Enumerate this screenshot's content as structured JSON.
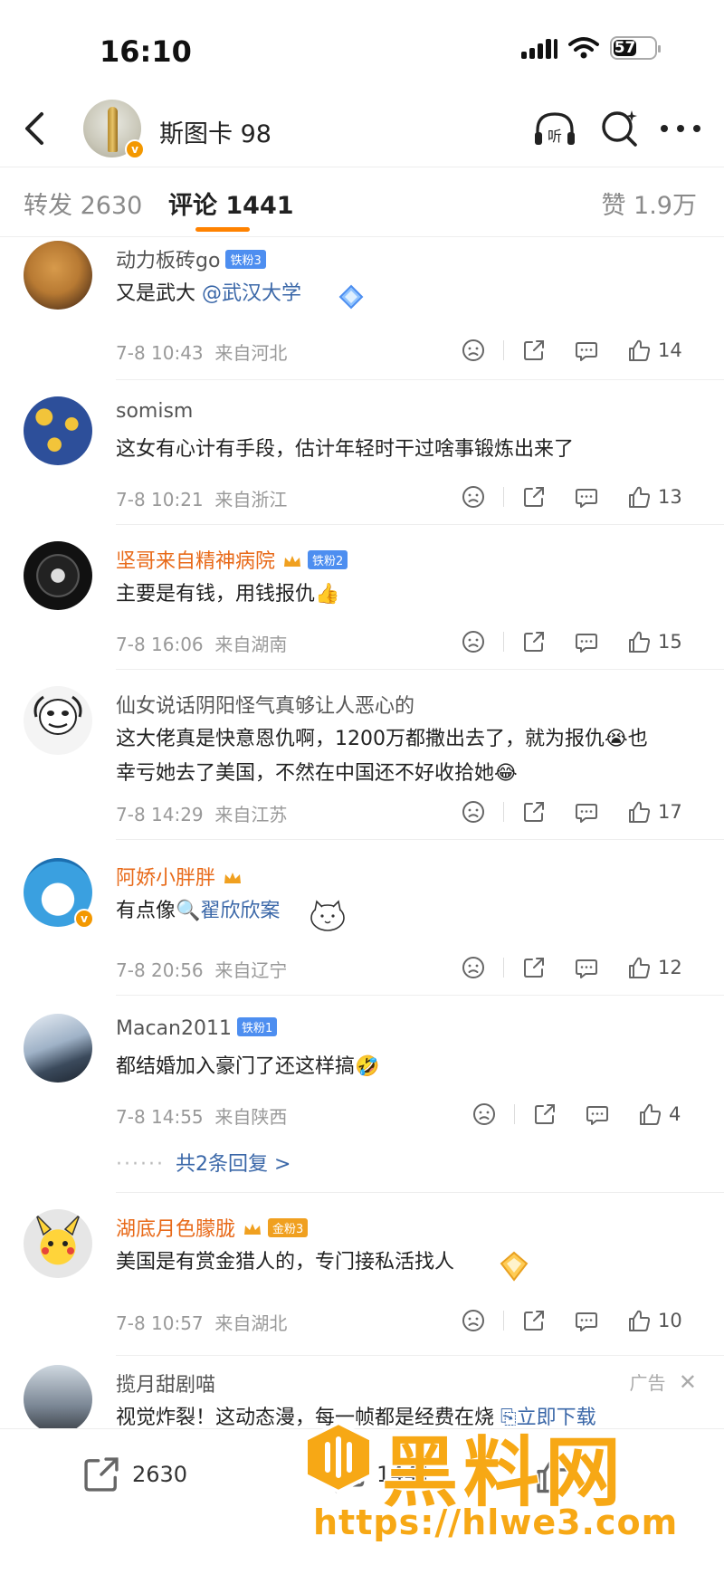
{
  "status_bar": {
    "time": "16:10",
    "battery": "57"
  },
  "nav": {
    "title": "斯图卡 98"
  },
  "tabs": {
    "repost": "转发 2630",
    "comments": "评论 1441",
    "likes": "赞 1.9万"
  },
  "comments": [
    {
      "user": "动力板砖go",
      "fan_badge": "铁粉3",
      "text": "又是武大",
      "mention": "@武汉大学",
      "time": "7-8 10:43",
      "location": "来自河北",
      "likes": "14"
    },
    {
      "user": "somism",
      "text": "这女有心计有手段，估计年轻时干过啥事锻炼出来了",
      "time": "7-8 10:21",
      "location": "来自浙江",
      "likes": "13"
    },
    {
      "user": "坚哥来自精神病院",
      "fan_badge": "铁粉2",
      "text": "主要是有钱，用钱报仇👍",
      "time": "7-8 16:06",
      "location": "来自湖南",
      "likes": "15"
    },
    {
      "user": "仙女说话阴阳怪气真够让人恶心的",
      "text_line1": "这大佬真是快意恩仇啊，1200万都撒出去了，就为报仇😭也",
      "text_line2": "幸亏她去了美国，不然在中国还不好收拾她😂",
      "time": "7-8 14:29",
      "location": "来自江苏",
      "likes": "17"
    },
    {
      "user": "阿娇小胖胖",
      "text": "有点像",
      "mention": "🔍翟欣欣案",
      "time": "7-8 20:56",
      "location": "来自辽宁",
      "likes": "12"
    },
    {
      "user": "Macan2011",
      "fan_badge": "铁粉1",
      "text": "都结婚加入豪门了还这样搞🤣",
      "time": "7-8 14:55",
      "location": "来自陕西",
      "likes": "4",
      "replies": "共2条回复 >"
    },
    {
      "user": "湖底月色朦胧",
      "fan_badge": "金粉3",
      "text": "美国是有赏金猎人的，专门接私活找人",
      "time": "7-8 10:57",
      "location": "来自湖北",
      "likes": "10"
    },
    {
      "user": "揽月甜剧喵",
      "text": "视觉炸裂！这动态漫，每一帧都是经费在烧",
      "ad_label": "广告",
      "ad_cta": "立即下载"
    }
  ],
  "bottom_bar": {
    "repost_count": "2630",
    "comment_count": "1441"
  },
  "watermark": {
    "title": "黑料网",
    "url": "https://hlwe3.com"
  },
  "colors": {
    "accent": "#ff8200",
    "link": "#3a67a8",
    "vip_name": "#e86a19",
    "watermark": "#f7a815"
  }
}
